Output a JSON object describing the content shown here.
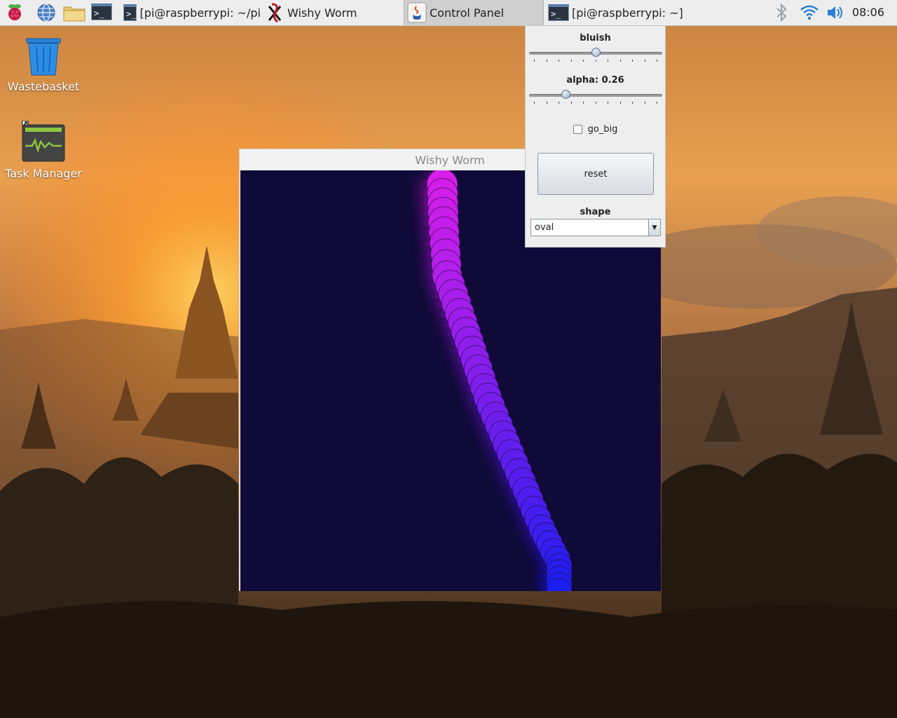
{
  "taskbar": {
    "tasks": [
      {
        "label": "[pi@raspberrypi: ~/pi...",
        "icon": "terminal-icon",
        "active": false
      },
      {
        "label": "Wishy Worm",
        "icon": "processing-icon",
        "active": false
      },
      {
        "label": "Control Panel",
        "icon": "java-icon",
        "active": true
      },
      {
        "label": "[pi@raspberrypi: ~]",
        "icon": "terminal-icon",
        "active": false
      }
    ],
    "clock": "08:06",
    "launchers": [
      "raspberry-menu-icon",
      "web-browser-icon",
      "file-manager-icon",
      "terminal-icon"
    ],
    "tray": [
      "bluetooth-icon",
      "wifi-icon",
      "volume-icon"
    ]
  },
  "desktop": {
    "icons": [
      {
        "label": "Wastebasket",
        "icon": "trash-icon"
      },
      {
        "label": "Task Manager",
        "icon": "task-manager-icon"
      }
    ]
  },
  "worm_window": {
    "title": "Wishy Worm"
  },
  "control_panel": {
    "bluish": {
      "label": "bluish",
      "value": 0.5
    },
    "alpha": {
      "label": "alpha: 0.26",
      "value": 0.26
    },
    "go_big": {
      "label": "go_big",
      "checked": false
    },
    "reset_label": "reset",
    "shape": {
      "label": "shape",
      "selected": "oval"
    },
    "colors": {
      "worm_start": "#d81ee8",
      "worm_end": "#1a1ef0",
      "canvas_bg": "#0f0a38"
    }
  },
  "term_prompt": ">_"
}
